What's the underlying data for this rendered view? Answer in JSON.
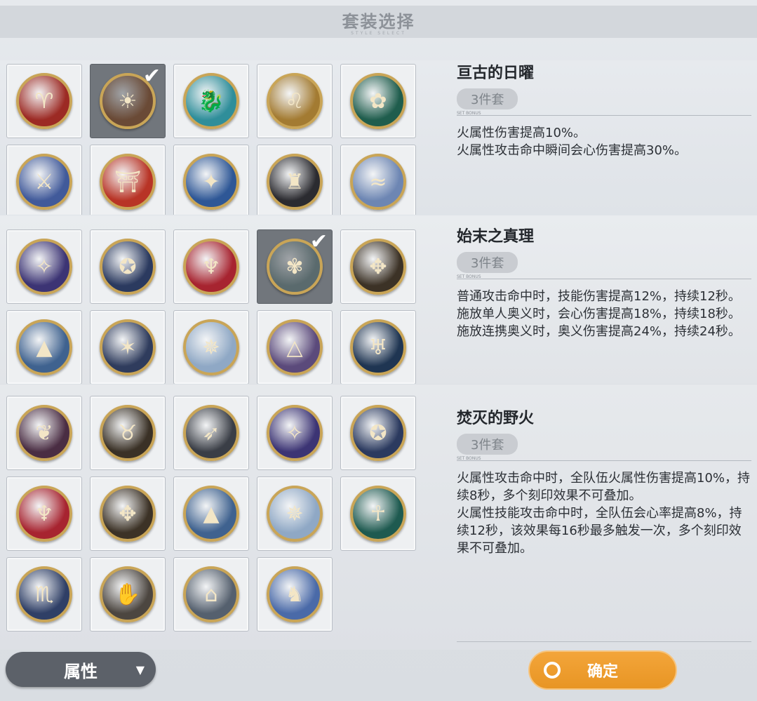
{
  "header": {
    "title": "套装选择",
    "subtitle": "STYLE SELECT"
  },
  "sections": [
    {
      "name": "亘古的日曜",
      "badge": "3件套",
      "divider_text": "SET BONUS",
      "desc": "火属性伤害提高10%。\n火属性攻击命中瞬间会心伤害提高30%。",
      "selected_index": 1,
      "emblems": [
        {
          "icon": "ram-emblem-icon",
          "glyph": "♈",
          "color": "#9c2a24"
        },
        {
          "icon": "sun-emblem-icon",
          "glyph": "☀",
          "color": "#6a4a36"
        },
        {
          "icon": "dragon-emblem-icon",
          "glyph": "🐉",
          "color": "#2f8e9a"
        },
        {
          "icon": "lion-emblem-icon",
          "glyph": "♌",
          "color": "#a37b32"
        },
        {
          "icon": "flower-emblem-icon",
          "glyph": "✿",
          "color": "#1f5d4d"
        },
        {
          "icon": "sword-emblem-icon",
          "glyph": "⚔",
          "color": "#415a9a"
        },
        {
          "icon": "gate-emblem-icon",
          "glyph": "⛩",
          "color": "#b83426"
        },
        {
          "icon": "flame-emblem-icon",
          "glyph": "✦",
          "color": "#2e5796"
        },
        {
          "icon": "tower-emblem-icon",
          "glyph": "♜",
          "color": "#2b2b30"
        },
        {
          "icon": "wave-emblem-icon",
          "glyph": "≈",
          "color": "#6d86b3"
        }
      ]
    },
    {
      "name": "始末之真理",
      "badge": "3件套",
      "divider_text": "SET BONUS",
      "desc": "普通攻击命中时，技能伤害提高12%，持续12秒。\n施放单人奥义时，会心伤害提高18%，持续18秒。\n施放连携奥义时，奥义伤害提高24%，持续24秒。",
      "selected_index": 3,
      "emblems": [
        {
          "icon": "crystal-emblem-icon",
          "glyph": "✧",
          "color": "#3c3474"
        },
        {
          "icon": "star-ring-emblem-icon",
          "glyph": "✪",
          "color": "#2b3a5f"
        },
        {
          "icon": "crimson-crest-emblem-icon",
          "glyph": "♆",
          "color": "#a72430"
        },
        {
          "icon": "knot-emblem-icon",
          "glyph": "✾",
          "color": "#5a6a6d"
        },
        {
          "icon": "gold-crest-emblem-icon",
          "glyph": "✥",
          "color": "#3c3226"
        },
        {
          "icon": "mountain-emblem-icon",
          "glyph": "▲",
          "color": "#3f628f"
        },
        {
          "icon": "fox-emblem-icon",
          "glyph": "✶",
          "color": "#2f3c5d"
        },
        {
          "icon": "ice-shard-emblem-icon",
          "glyph": "✵",
          "color": "#8fa8c5"
        },
        {
          "icon": "serpent-pyramid-emblem-icon",
          "glyph": "△",
          "color": "#5b4a7b"
        },
        {
          "icon": "blue-crest-emblem-icon",
          "glyph": "♅",
          "color": "#1f3552"
        }
      ]
    },
    {
      "name": "焚灭的野火",
      "badge": "3件套",
      "divider_text": "SET BONUS",
      "desc": "火属性攻击命中时，全队伍火属性伤害提高10%，持续8秒，多个刻印效果不可叠加。\n火属性技能攻击命中时，全队伍会心率提高8%，持续12秒，该效果每16秒最多触发一次，多个刻印效果不可叠加。",
      "selected_index": 16,
      "emblems": [
        {
          "icon": "dark-wings-emblem-icon",
          "glyph": "❦",
          "color": "#4a2d43"
        },
        {
          "icon": "tiger-emblem-icon",
          "glyph": "♉",
          "color": "#3a3126"
        },
        {
          "icon": "feather-emblem-icon",
          "glyph": "➶",
          "color": "#3a3e46"
        },
        {
          "icon": "crystal-emblem-icon",
          "glyph": "✧",
          "color": "#3c3474"
        },
        {
          "icon": "star-ring-emblem-icon",
          "glyph": "✪",
          "color": "#2b3a5f"
        },
        {
          "icon": "crimson-crest-emblem-icon",
          "glyph": "♆",
          "color": "#a72430"
        },
        {
          "icon": "gold-crest-emblem-icon",
          "glyph": "✥",
          "color": "#3c3226"
        },
        {
          "icon": "mountain-emblem-icon",
          "glyph": "▲",
          "color": "#3f628f"
        },
        {
          "icon": "ice-shard-emblem-icon",
          "glyph": "✵",
          "color": "#8fa8c5"
        },
        {
          "icon": "pharaoh-emblem-icon",
          "glyph": "☥",
          "color": "#1e5a50"
        },
        {
          "icon": "scorpion-emblem-icon",
          "glyph": "♏",
          "color": "#2f3f66"
        },
        {
          "icon": "claw-emblem-icon",
          "glyph": "✋",
          "color": "#4c4640"
        },
        {
          "icon": "temple-emblem-icon",
          "glyph": "⌂",
          "color": "#55606e"
        },
        {
          "icon": "pegasus-emblem-icon",
          "glyph": "♞",
          "color": "#4a6aa8"
        }
      ]
    }
  ],
  "buttons": {
    "attribute_label": "属性",
    "attribute_arrow": "▼",
    "confirm_label": "确定"
  },
  "colors": {
    "accent_orange": "#e89524",
    "selected_card": "#71767c",
    "dark_button": "#5c6169"
  }
}
